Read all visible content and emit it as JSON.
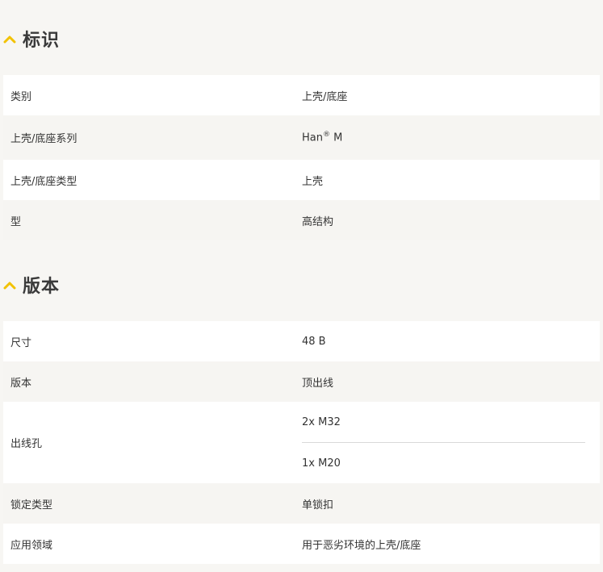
{
  "sections": [
    {
      "title": "标识",
      "rows": [
        {
          "label": "类别",
          "value": "上壳/底座"
        },
        {
          "label": "上壳/底座系列",
          "value": "Han",
          "value_sup": "®",
          "value_suffix": " M"
        },
        {
          "label": "上壳/底座类型",
          "value": "上壳"
        },
        {
          "label": "型",
          "value": "高结构"
        }
      ]
    },
    {
      "title": "版本",
      "rows": [
        {
          "label": "尺寸",
          "value": "48 B"
        },
        {
          "label": "版本",
          "value": "顶出线"
        },
        {
          "label": "出线孔",
          "values": [
            "2x M32",
            "1x M20"
          ]
        },
        {
          "label": "锁定类型",
          "value": "单锁扣"
        },
        {
          "label": "应用领域",
          "value": "用于恶劣环境的上壳/底座"
        }
      ]
    }
  ],
  "icons": {
    "section_toggle": "chevron-up-icon"
  },
  "colors": {
    "accent": "#f2c200",
    "row_white": "#ffffff",
    "row_grey": "#f6f5f2",
    "background": "#f7f6f3"
  }
}
